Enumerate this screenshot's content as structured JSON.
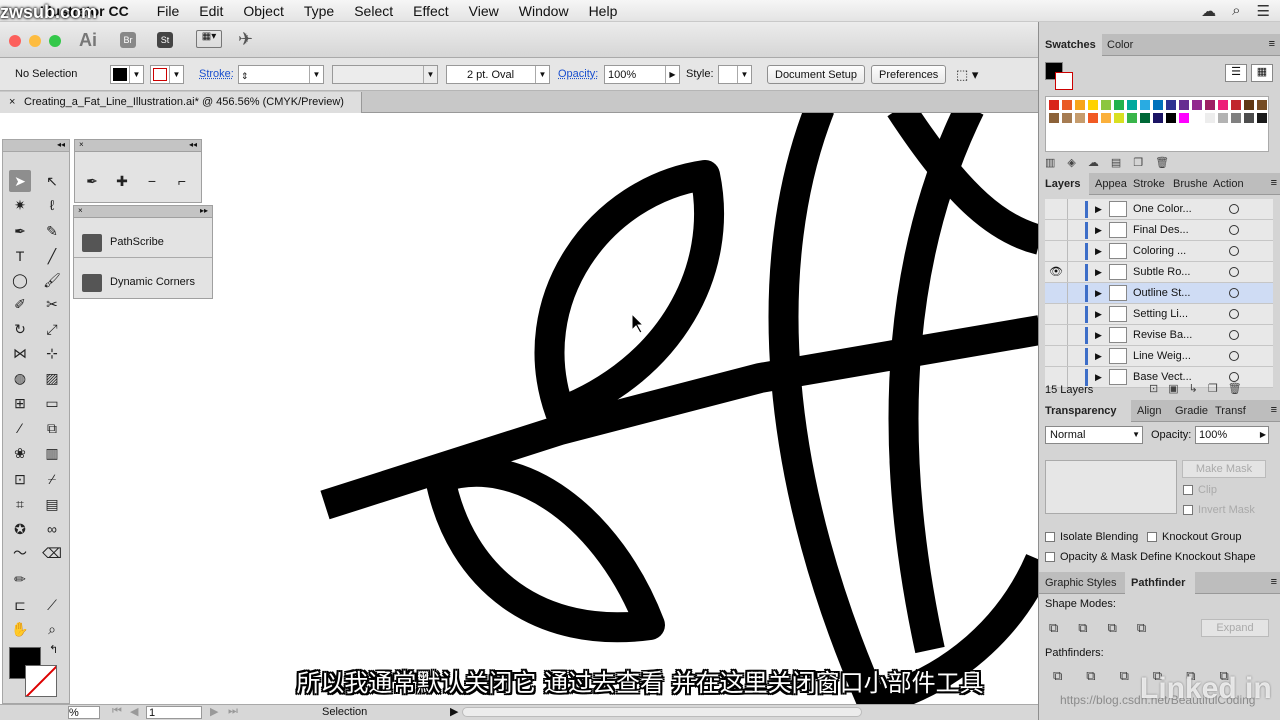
{
  "menubar": {
    "app_name": "Illustrator CC",
    "items": [
      "File",
      "Edit",
      "Object",
      "Type",
      "Select",
      "Effect",
      "View",
      "Window",
      "Help"
    ]
  },
  "appbar": {
    "ai_label": "Ai",
    "br_label": "Br",
    "st_label": "St"
  },
  "control_bar": {
    "selection_label": "No Selection",
    "stroke_label": "Stroke:",
    "brush_label": "2 pt. Oval",
    "opacity_label": "Opacity:",
    "opacity_value": "100%",
    "style_label": "Style:",
    "doc_setup_label": "Document Setup",
    "preferences_label": "Preferences"
  },
  "document_tab": {
    "title": "Creating_a_Fat_Line_Illustration.ai* @ 456.56% (CMYK/Preview)"
  },
  "floating_panels": {
    "pathscribe": "PathScribe",
    "dynamic_corners": "Dynamic Corners"
  },
  "status_bar": {
    "zoom": "%",
    "page": "1",
    "mode": "Selection"
  },
  "swatches_panel": {
    "tabs": [
      "Swatches",
      "Color"
    ],
    "colors": [
      "#d9241b",
      "#ea5b25",
      "#f7a51b",
      "#ffd200",
      "#8cc63f",
      "#22b24c",
      "#00a99d",
      "#29abe2",
      "#0071bc",
      "#2e3192",
      "#662d91",
      "#92278f",
      "#9e1f63",
      "#ed1e79",
      "#c1272d",
      "#603813",
      "#754c24",
      "#8c6239",
      "#a67c52",
      "#c69c6d",
      "#f15a24",
      "#fbb03b",
      "#d9e021",
      "#39b54a",
      "#006837",
      "#1b1464",
      "#000000",
      "#ff00ff",
      "#ffffff",
      "#ededed",
      "#b3b3b3",
      "#808080",
      "#4d4d4d",
      "#1a1a1a"
    ]
  },
  "layers_panel": {
    "tabs": [
      "Layers",
      "Appea",
      "Stroke",
      "Brushe",
      "Action"
    ],
    "layers": [
      "One Color...",
      "Final Des...",
      "Coloring ...",
      "Subtle Ro...",
      "Outline St...",
      "Setting Li...",
      "Revise Ba...",
      "Line Weig...",
      "Base Vect..."
    ],
    "count_label": "15 Layers"
  },
  "transparency_panel": {
    "tabs": [
      "Transparency",
      "Align",
      "Gradie",
      "Transf"
    ],
    "blend_mode": "Normal",
    "opacity_label": "Opacity:",
    "opacity_value": "100%",
    "make_mask": "Make Mask",
    "clip": "Clip",
    "invert_mask": "Invert Mask",
    "isolate_blending": "Isolate Blending",
    "knockout_group": "Knockout Group",
    "opacity_mask_knockout": "Opacity & Mask Define Knockout Shape"
  },
  "pathfinder_panel": {
    "tabs": [
      "Graphic Styles",
      "Pathfinder"
    ],
    "shape_modes_label": "Shape Modes:",
    "expand_label": "Expand",
    "pathfinders_label": "Pathfinders:"
  },
  "overlay": {
    "subtitle": "所以我通常默认关闭它  通过去查看  并在这里关闭窗口小部件工具",
    "watermark": "zwsub.com",
    "linkedin": "Linked in",
    "blog": "https://blog.csdn.net/BeautifulCoding"
  }
}
